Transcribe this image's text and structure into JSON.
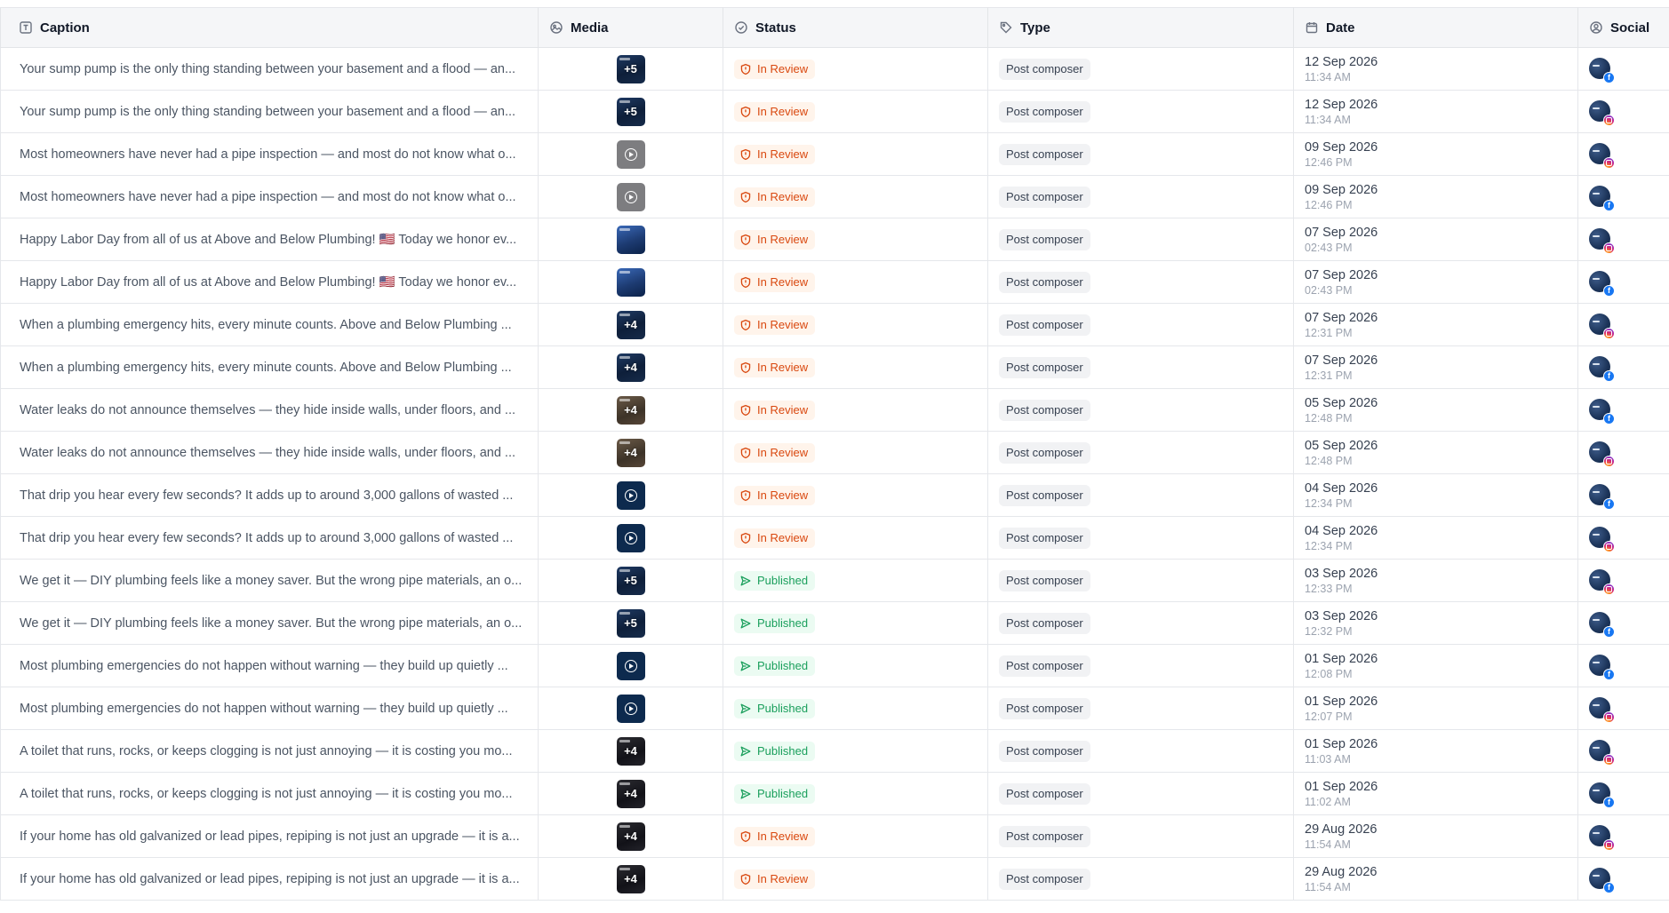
{
  "columns": {
    "caption": "Caption",
    "media": "Media",
    "status": "Status",
    "type": "Type",
    "date": "Date",
    "social": "Social"
  },
  "icons": {
    "caption": "text-box-icon",
    "media": "media-icon",
    "status": "check-circle-icon",
    "type": "tag-icon",
    "date": "calendar-icon",
    "social": "user-circle-icon",
    "in_review": "alert-shield-icon",
    "published": "send-icon"
  },
  "colors": {
    "in_review": "#d9480f",
    "in_review_bg": "#fff4eb",
    "published": "#1a9f5c",
    "published_bg": "#ebfbf2",
    "facebook": "#1877f2"
  },
  "rows": [
    {
      "caption": "Your sump pump is the only thing standing between your basement and a flood — an...",
      "media": "carousel",
      "media_count": "+5",
      "media_style": "",
      "status": "In Review",
      "status_kind": "review",
      "type": "Post composer",
      "date": "12 Sep 2026",
      "time": "11:34 AM",
      "network": "facebook"
    },
    {
      "caption": "Your sump pump is the only thing standing between your basement and a flood — an...",
      "media": "carousel",
      "media_count": "+5",
      "media_style": "",
      "status": "In Review",
      "status_kind": "review",
      "type": "Post composer",
      "date": "12 Sep 2026",
      "time": "11:34 AM",
      "network": "instagram"
    },
    {
      "caption": "Most homeowners have never had a pipe inspection — and most do not know what o...",
      "media": "video-gray",
      "media_count": "",
      "media_style": "",
      "status": "In Review",
      "status_kind": "review",
      "type": "Post composer",
      "date": "09 Sep 2026",
      "time": "12:46 PM",
      "network": "instagram"
    },
    {
      "caption": "Most homeowners have never had a pipe inspection — and most do not know what o...",
      "media": "video-gray",
      "media_count": "",
      "media_style": "",
      "status": "In Review",
      "status_kind": "review",
      "type": "Post composer",
      "date": "09 Sep 2026",
      "time": "12:46 PM",
      "network": "facebook"
    },
    {
      "caption": "Happy Labor Day from all of us at Above and Below Plumbing! 🇺🇸 Today we honor ev...",
      "media": "carousel",
      "media_count": "",
      "media_style": "blue",
      "status": "In Review",
      "status_kind": "review",
      "type": "Post composer",
      "date": "07 Sep 2026",
      "time": "02:43 PM",
      "network": "instagram"
    },
    {
      "caption": "Happy Labor Day from all of us at Above and Below Plumbing! 🇺🇸 Today we honor ev...",
      "media": "carousel",
      "media_count": "",
      "media_style": "blue",
      "status": "In Review",
      "status_kind": "review",
      "type": "Post composer",
      "date": "07 Sep 2026",
      "time": "02:43 PM",
      "network": "facebook"
    },
    {
      "caption": "When a plumbing emergency hits, every minute counts. Above and Below Plumbing ...",
      "media": "carousel",
      "media_count": "+4",
      "media_style": "",
      "status": "In Review",
      "status_kind": "review",
      "type": "Post composer",
      "date": "07 Sep 2026",
      "time": "12:31 PM",
      "network": "instagram"
    },
    {
      "caption": "When a plumbing emergency hits, every minute counts. Above and Below Plumbing ...",
      "media": "carousel",
      "media_count": "+4",
      "media_style": "",
      "status": "In Review",
      "status_kind": "review",
      "type": "Post composer",
      "date": "07 Sep 2026",
      "time": "12:31 PM",
      "network": "facebook"
    },
    {
      "caption": "Water leaks do not announce themselves — they hide inside walls, under floors, and ...",
      "media": "carousel",
      "media_count": "+4",
      "media_style": "brown",
      "status": "In Review",
      "status_kind": "review",
      "type": "Post composer",
      "date": "05 Sep 2026",
      "time": "12:48 PM",
      "network": "facebook"
    },
    {
      "caption": "Water leaks do not announce themselves — they hide inside walls, under floors, and ...",
      "media": "carousel",
      "media_count": "+4",
      "media_style": "brown",
      "status": "In Review",
      "status_kind": "review",
      "type": "Post composer",
      "date": "05 Sep 2026",
      "time": "12:48 PM",
      "network": "instagram"
    },
    {
      "caption": "That drip you hear every few seconds? It adds up to around 3,000 gallons of wasted ...",
      "media": "video-navy",
      "media_count": "",
      "media_style": "",
      "status": "In Review",
      "status_kind": "review",
      "type": "Post composer",
      "date": "04 Sep 2026",
      "time": "12:34 PM",
      "network": "facebook"
    },
    {
      "caption": "That drip you hear every few seconds? It adds up to around 3,000 gallons of wasted ...",
      "media": "video-navy",
      "media_count": "",
      "media_style": "",
      "status": "In Review",
      "status_kind": "review",
      "type": "Post composer",
      "date": "04 Sep 2026",
      "time": "12:34 PM",
      "network": "instagram"
    },
    {
      "caption": "We get it — DIY plumbing feels like a money saver. But the wrong pipe materials, an o...",
      "media": "carousel",
      "media_count": "+5",
      "media_style": "",
      "status": "Published",
      "status_kind": "published",
      "type": "Post composer",
      "date": "03 Sep 2026",
      "time": "12:33 PM",
      "network": "instagram"
    },
    {
      "caption": "We get it — DIY plumbing feels like a money saver. But the wrong pipe materials, an o...",
      "media": "carousel",
      "media_count": "+5",
      "media_style": "",
      "status": "Published",
      "status_kind": "published",
      "type": "Post composer",
      "date": "03 Sep 2026",
      "time": "12:32 PM",
      "network": "facebook"
    },
    {
      "caption": "Most plumbing emergencies do not happen without warning — they build up quietly ...",
      "media": "video-navy",
      "media_count": "",
      "media_style": "",
      "status": "Published",
      "status_kind": "published",
      "type": "Post composer",
      "date": "01 Sep 2026",
      "time": "12:08 PM",
      "network": "facebook"
    },
    {
      "caption": "Most plumbing emergencies do not happen without warning — they build up quietly ...",
      "media": "video-navy",
      "media_count": "",
      "media_style": "",
      "status": "Published",
      "status_kind": "published",
      "type": "Post composer",
      "date": "01 Sep 2026",
      "time": "12:07 PM",
      "network": "instagram"
    },
    {
      "caption": "A toilet that runs, rocks, or keeps clogging is not just annoying — it is costing you mo...",
      "media": "carousel",
      "media_count": "+4",
      "media_style": "dark",
      "status": "Published",
      "status_kind": "published",
      "type": "Post composer",
      "date": "01 Sep 2026",
      "time": "11:03 AM",
      "network": "instagram"
    },
    {
      "caption": "A toilet that runs, rocks, or keeps clogging is not just annoying — it is costing you mo...",
      "media": "carousel",
      "media_count": "+4",
      "media_style": "dark",
      "status": "Published",
      "status_kind": "published",
      "type": "Post composer",
      "date": "01 Sep 2026",
      "time": "11:02 AM",
      "network": "facebook"
    },
    {
      "caption": "If your home has old galvanized or lead pipes, repiping is not just an upgrade — it is a...",
      "media": "carousel",
      "media_count": "+4",
      "media_style": "dark",
      "status": "In Review",
      "status_kind": "review",
      "type": "Post composer",
      "date": "29 Aug 2026",
      "time": "11:54 AM",
      "network": "instagram"
    },
    {
      "caption": "If your home has old galvanized or lead pipes, repiping is not just an upgrade — it is a...",
      "media": "carousel",
      "media_count": "+4",
      "media_style": "dark",
      "status": "In Review",
      "status_kind": "review",
      "type": "Post composer",
      "date": "29 Aug 2026",
      "time": "11:54 AM",
      "network": "facebook"
    }
  ]
}
